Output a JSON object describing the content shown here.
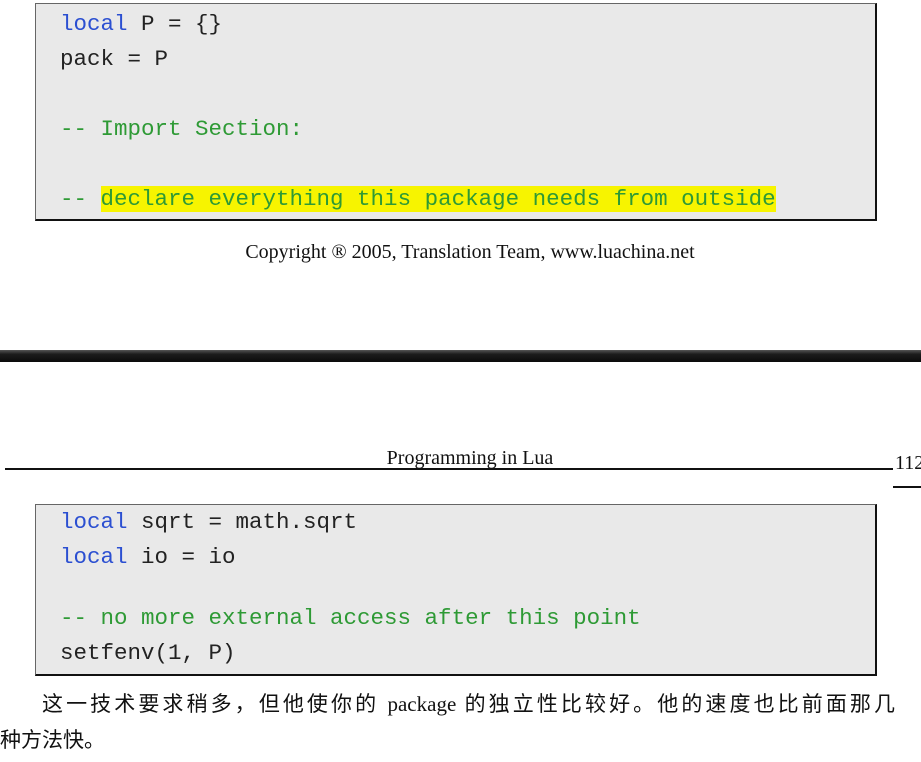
{
  "code_block_top": {
    "lines": [
      {
        "keyword": "local",
        "text": " P = {}"
      },
      {
        "text": "pack = P"
      },
      {
        "comment": "-- Import Section:"
      },
      {
        "comment": "-- ",
        "highlighted_comment": "declare everything this package needs from outside"
      }
    ]
  },
  "copyright": "Copyright ® 2005, Translation Team, www.luachina.net",
  "header": {
    "title": "Programming in Lua",
    "page_number": "112"
  },
  "code_block_bottom": {
    "lines": [
      {
        "keyword": "local",
        "text": " sqrt = math.sqrt"
      },
      {
        "keyword": "local",
        "text": " io = io"
      },
      {
        "comment": "-- no more external access after this point"
      },
      {
        "text": "setfenv(1, P)"
      }
    ]
  },
  "paragraph": {
    "lines": [
      "这一技术要求稍多，但他使你的 package 的独立性比较好。他的速度也比前面那几",
      "种方法快。"
    ]
  },
  "colors": {
    "keyword": "#2b4fd1",
    "comment": "#2e9a35",
    "highlight": "#f7f400",
    "code_background": "#e9e9e9"
  }
}
